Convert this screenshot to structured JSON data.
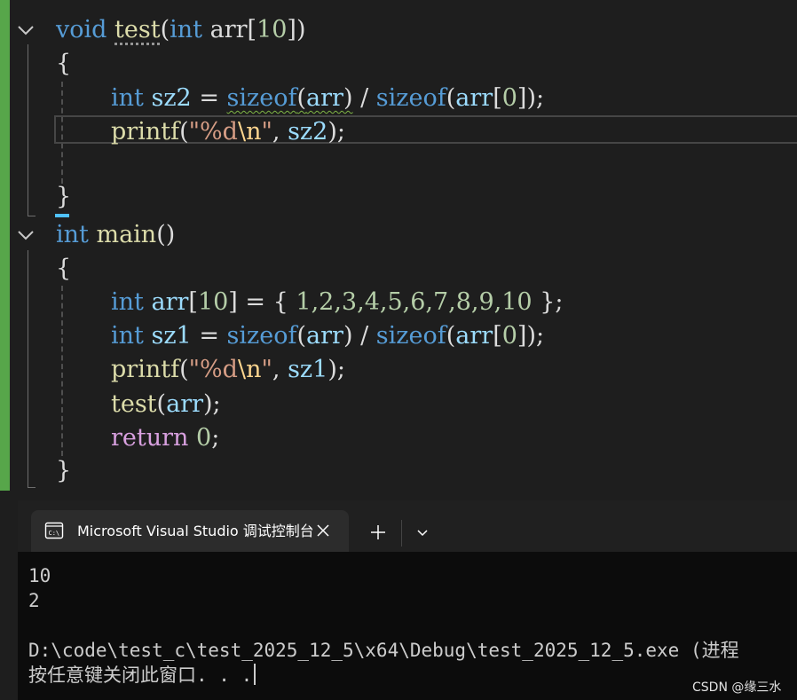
{
  "editor": {
    "code": {
      "test_sig": {
        "kw": "void",
        "name": "test",
        "paren_open": "(",
        "ptype": "int",
        "pname": "arr",
        "bracket": "[",
        "size": "10",
        "close": "])"
      },
      "test_open": "{",
      "sz2_line": {
        "kw": "int",
        "var": "sz2",
        "eq": " = ",
        "sizeof1": "sizeof",
        "p1": "(",
        "arg1": "arr",
        "p1c": ")",
        "div": " / ",
        "sizeof2": "sizeof",
        "p2": "(",
        "arg2": "arr",
        "idx_open": "[",
        "idx": "0",
        "idx_close": "]);"
      },
      "printf2_line": {
        "fn": "printf",
        "open": "(",
        "str1": "\"%d",
        "esc": "\\n",
        "str2": "\"",
        "sep": ", ",
        "arg": "sz2",
        "end": ");"
      },
      "test_close": "}",
      "main_sig": {
        "kw": "int",
        "name": "main",
        "parens": "()"
      },
      "main_open": "{",
      "arr_line": {
        "kw": "int",
        "var": "arr",
        "bracket_open": "[",
        "size": "10",
        "bracket_close": "]",
        "eq": " = { ",
        "values": "1,2,3,4,5,6,7,8,9,10",
        "end": " };"
      },
      "sz1_line": {
        "kw": "int",
        "var": "sz1",
        "eq": " = ",
        "sizeof1": "sizeof",
        "p1": "(",
        "arg1": "arr",
        "p1c": ")",
        "div": " / ",
        "sizeof2": "sizeof",
        "p2": "(",
        "arg2": "arr",
        "idx_open": "[",
        "idx": "0",
        "idx_close": "]);"
      },
      "printf1_line": {
        "fn": "printf",
        "open": "(",
        "str1": "\"%d",
        "esc": "\\n",
        "str2": "\"",
        "sep": ", ",
        "arg": "sz1",
        "end": ");"
      },
      "call_line": {
        "fn": "test",
        "open": "(",
        "arg": "arr",
        "end": ");"
      },
      "return_line": {
        "kw": "return",
        "space": " ",
        "value": "0",
        "end": ";"
      },
      "main_close": "}"
    }
  },
  "terminal": {
    "tab_title": "Microsoft Visual Studio 调试控制台",
    "output": [
      "10",
      "2",
      "",
      "D:\\code\\test_c\\test_2025_12_5\\x64\\Debug\\test_2025_12_5.exe (进程",
      "按任意键关闭此窗口. . ."
    ]
  },
  "watermark": "CSDN @缘三水",
  "colors": {
    "keyword": "#569cd6",
    "control_keyword": "#d8a0df",
    "function": "#dcdcaa",
    "parameter": "#9cdcfe",
    "number": "#b5cea8",
    "string": "#d69d85",
    "escape": "#ffd68f",
    "change_bar": "#57a64a"
  }
}
